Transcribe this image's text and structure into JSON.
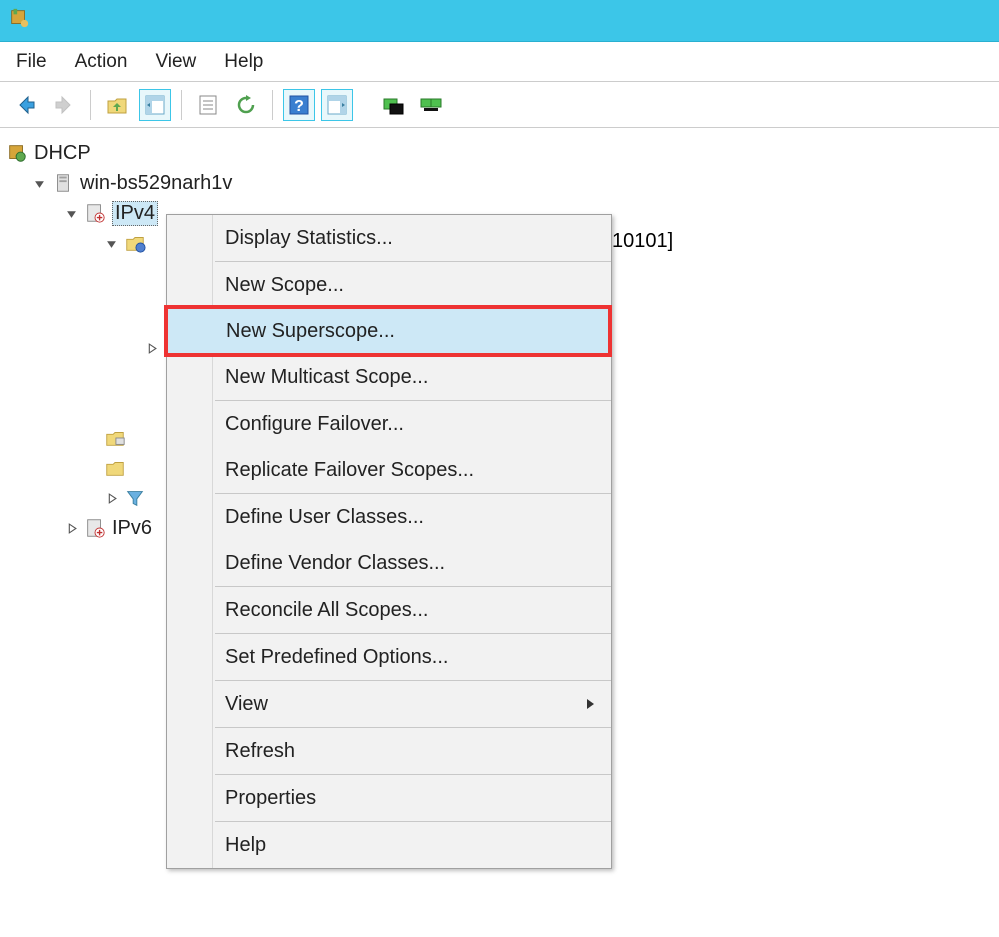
{
  "menubar": {
    "file": "File",
    "action": "Action",
    "view": "View",
    "help": "Help"
  },
  "tree": {
    "root": "DHCP",
    "server": "win-bs529narh1v",
    "ipv4": "IPv4",
    "ipv6": "IPv6",
    "scope_extra": "10101]"
  },
  "context_menu": {
    "display_stats": "Display Statistics...",
    "new_scope": "New Scope...",
    "new_superscope": "New Superscope...",
    "new_multicast": "New Multicast Scope...",
    "configure_failover": "Configure Failover...",
    "replicate_failover": "Replicate Failover Scopes...",
    "define_user_classes": "Define User Classes...",
    "define_vendor_classes": "Define Vendor Classes...",
    "reconcile": "Reconcile All Scopes...",
    "set_predefined": "Set Predefined Options...",
    "view": "View",
    "refresh": "Refresh",
    "properties": "Properties",
    "help": "Help"
  }
}
